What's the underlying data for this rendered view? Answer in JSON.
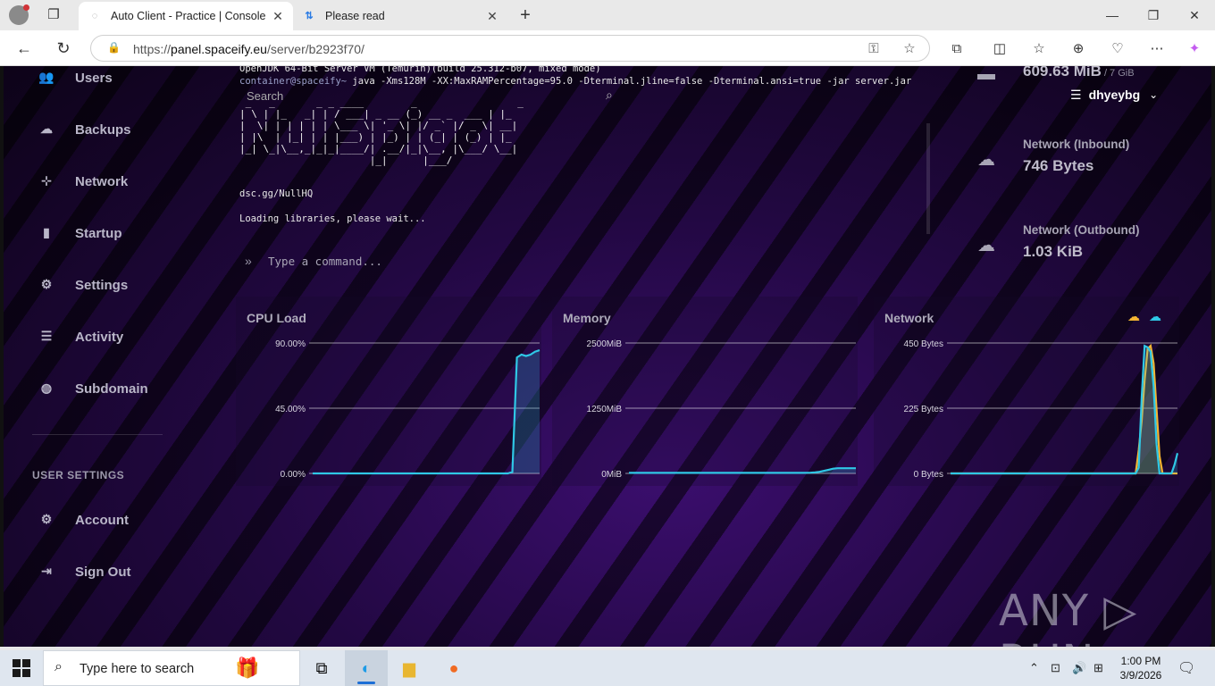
{
  "browser": {
    "tabs": [
      {
        "title": "Auto Client - Practice | Console",
        "favicon": "spaceify-icon",
        "active": true
      },
      {
        "title": "Please read",
        "favicon": "arrows-icon",
        "active": false
      }
    ],
    "url_prefix": "https://",
    "url_host": "panel.spaceify.eu",
    "url_path": "/server/b2923f70/"
  },
  "sidebar": {
    "items": [
      {
        "label": "Users",
        "icon": "users-icon",
        "glyph": "👥"
      },
      {
        "label": "Backups",
        "icon": "cloud-icon",
        "glyph": "☁"
      },
      {
        "label": "Network",
        "icon": "network-icon",
        "glyph": "⊹"
      },
      {
        "label": "Startup",
        "icon": "chart-icon",
        "glyph": "▮"
      },
      {
        "label": "Settings",
        "icon": "cogs-icon",
        "glyph": "⚙"
      },
      {
        "label": "Activity",
        "icon": "list-icon",
        "glyph": "☰"
      },
      {
        "label": "Subdomain",
        "icon": "globe-icon",
        "glyph": "◍"
      }
    ],
    "user_settings_heading": "USER SETTINGS",
    "user_items": [
      {
        "label": "Account",
        "icon": "cogs-icon",
        "glyph": "⚙"
      },
      {
        "label": "Sign Out",
        "icon": "sign-out-icon",
        "glyph": "⇥"
      }
    ]
  },
  "console": {
    "line1": "OpenJDK 64-Bit Server VM (Temurin)(build 25.312-b07, mixed mode)",
    "prompt": "container@spaceify~",
    "command": " java -Xms128M -XX:MaxRAMPercentage=95.0 -Dterminal.jline=false -Dterminal.ansi=true -jar server.jar",
    "search_placeholder": "Search",
    "ascii_art": " _   _       _ _ ____        _                 _   \n| \\ | |_   _| | / ___| _ __ (_) __ _  ___ | |_ \n|  \\| | | | | | \\___ \\| '_ \\| |/ _` |/ _ \\| __|\n| |\\  | |_| | | |___) | |_) | | (_| | (_) | |_ \n|_| \\_|\\__,_|_|_|____/| .__/|_|\\__, |\\___/ \\__|\n                      |_|      |___/           ",
    "discord": "dsc.gg/NullHQ",
    "loading": "Loading libraries, please wait...",
    "command_placeholder": "Type a command..."
  },
  "stats": {
    "memory_value": "609.63 MiB",
    "memory_limit": " / 7 GiB",
    "inbound_label": "Network (Inbound)",
    "inbound_value": "746 Bytes",
    "outbound_label": "Network (Outbound)",
    "outbound_value": "1.03 KiB"
  },
  "user": {
    "name": "dhyeybg"
  },
  "charts": {
    "cpu": {
      "title": "CPU Load",
      "ticks": [
        "90.00%",
        "45.00%",
        "0.00%"
      ]
    },
    "memory": {
      "title": "Memory",
      "ticks": [
        "2500MiB",
        "1250MiB",
        "0MiB"
      ]
    },
    "network": {
      "title": "Network",
      "ticks": [
        "450 Bytes",
        "225 Bytes",
        "0 Bytes"
      ]
    }
  },
  "chart_data": [
    {
      "type": "area",
      "title": "CPU Load",
      "ylim": [
        0,
        90
      ],
      "yticks": [
        "90.00%",
        "45.00%",
        "0.00%"
      ],
      "series": [
        {
          "values": [
            0,
            0,
            0,
            0,
            0,
            0,
            0,
            0,
            0,
            0,
            0,
            0,
            0,
            0,
            0,
            0,
            0,
            0,
            0,
            0,
            0,
            0,
            0,
            0,
            0,
            0,
            0,
            0,
            0,
            0,
            0,
            0,
            0,
            0,
            0,
            0,
            0,
            0,
            0,
            0,
            0,
            0,
            0,
            0,
            1,
            80,
            82,
            81,
            82,
            84,
            85
          ]
        }
      ],
      "color": "#2fc8e6"
    },
    {
      "type": "area",
      "title": "Memory",
      "ylim": [
        0,
        2500
      ],
      "yticks": [
        "2500MiB",
        "1250MiB",
        "0MiB"
      ],
      "series": [
        {
          "values": [
            10,
            10,
            10,
            10,
            10,
            10,
            10,
            10,
            10,
            10,
            10,
            10,
            10,
            10,
            10,
            10,
            10,
            10,
            10,
            10,
            10,
            10,
            10,
            10,
            10,
            10,
            10,
            10,
            10,
            10,
            10,
            10,
            10,
            10,
            10,
            10,
            10,
            10,
            10,
            12,
            14,
            20,
            30,
            50,
            70,
            90,
            100,
            100,
            100,
            100,
            100
          ]
        }
      ],
      "color": "#2fc8e6"
    },
    {
      "type": "area",
      "title": "Network",
      "ylim": [
        0,
        450
      ],
      "yticks": [
        "450 Bytes",
        "225 Bytes",
        "0 Bytes"
      ],
      "series": [
        {
          "values": [
            0,
            0,
            0,
            0,
            0,
            0,
            0,
            0,
            0,
            0,
            0,
            0,
            0,
            0,
            0,
            0,
            0,
            0,
            0,
            0,
            0,
            0,
            0,
            0,
            0,
            0,
            0,
            0,
            0,
            0,
            0,
            0,
            0,
            0,
            0,
            0,
            0,
            0,
            0,
            0,
            0,
            0,
            0,
            0,
            0,
            0,
            0,
            0,
            0,
            0,
            0,
            0,
            0,
            0,
            0,
            0,
            0,
            0,
            0,
            0,
            0,
            0,
            0,
            80,
            180,
            320,
            430,
            440,
            380,
            220,
            60,
            0,
            0,
            0,
            0,
            0,
            0
          ],
          "color": "#f3b533"
        },
        {
          "values": [
            0,
            0,
            0,
            0,
            0,
            0,
            0,
            0,
            0,
            0,
            0,
            0,
            0,
            0,
            0,
            0,
            0,
            0,
            0,
            0,
            0,
            0,
            0,
            0,
            0,
            0,
            0,
            0,
            0,
            0,
            0,
            0,
            0,
            0,
            0,
            0,
            0,
            0,
            0,
            0,
            0,
            0,
            0,
            0,
            0,
            0,
            0,
            0,
            0,
            0,
            0,
            0,
            0,
            0,
            0,
            0,
            0,
            0,
            0,
            0,
            0,
            0,
            0,
            20,
            260,
            440,
            435,
            420,
            300,
            100,
            0,
            0,
            0,
            0,
            0,
            30,
            70
          ],
          "color": "#2fc8e6"
        }
      ]
    }
  ],
  "watermark": "ANY ▷ RUN",
  "taskbar": {
    "search_placeholder": "Type here to search",
    "time": "1:00 PM",
    "date": "3/9/2026"
  }
}
